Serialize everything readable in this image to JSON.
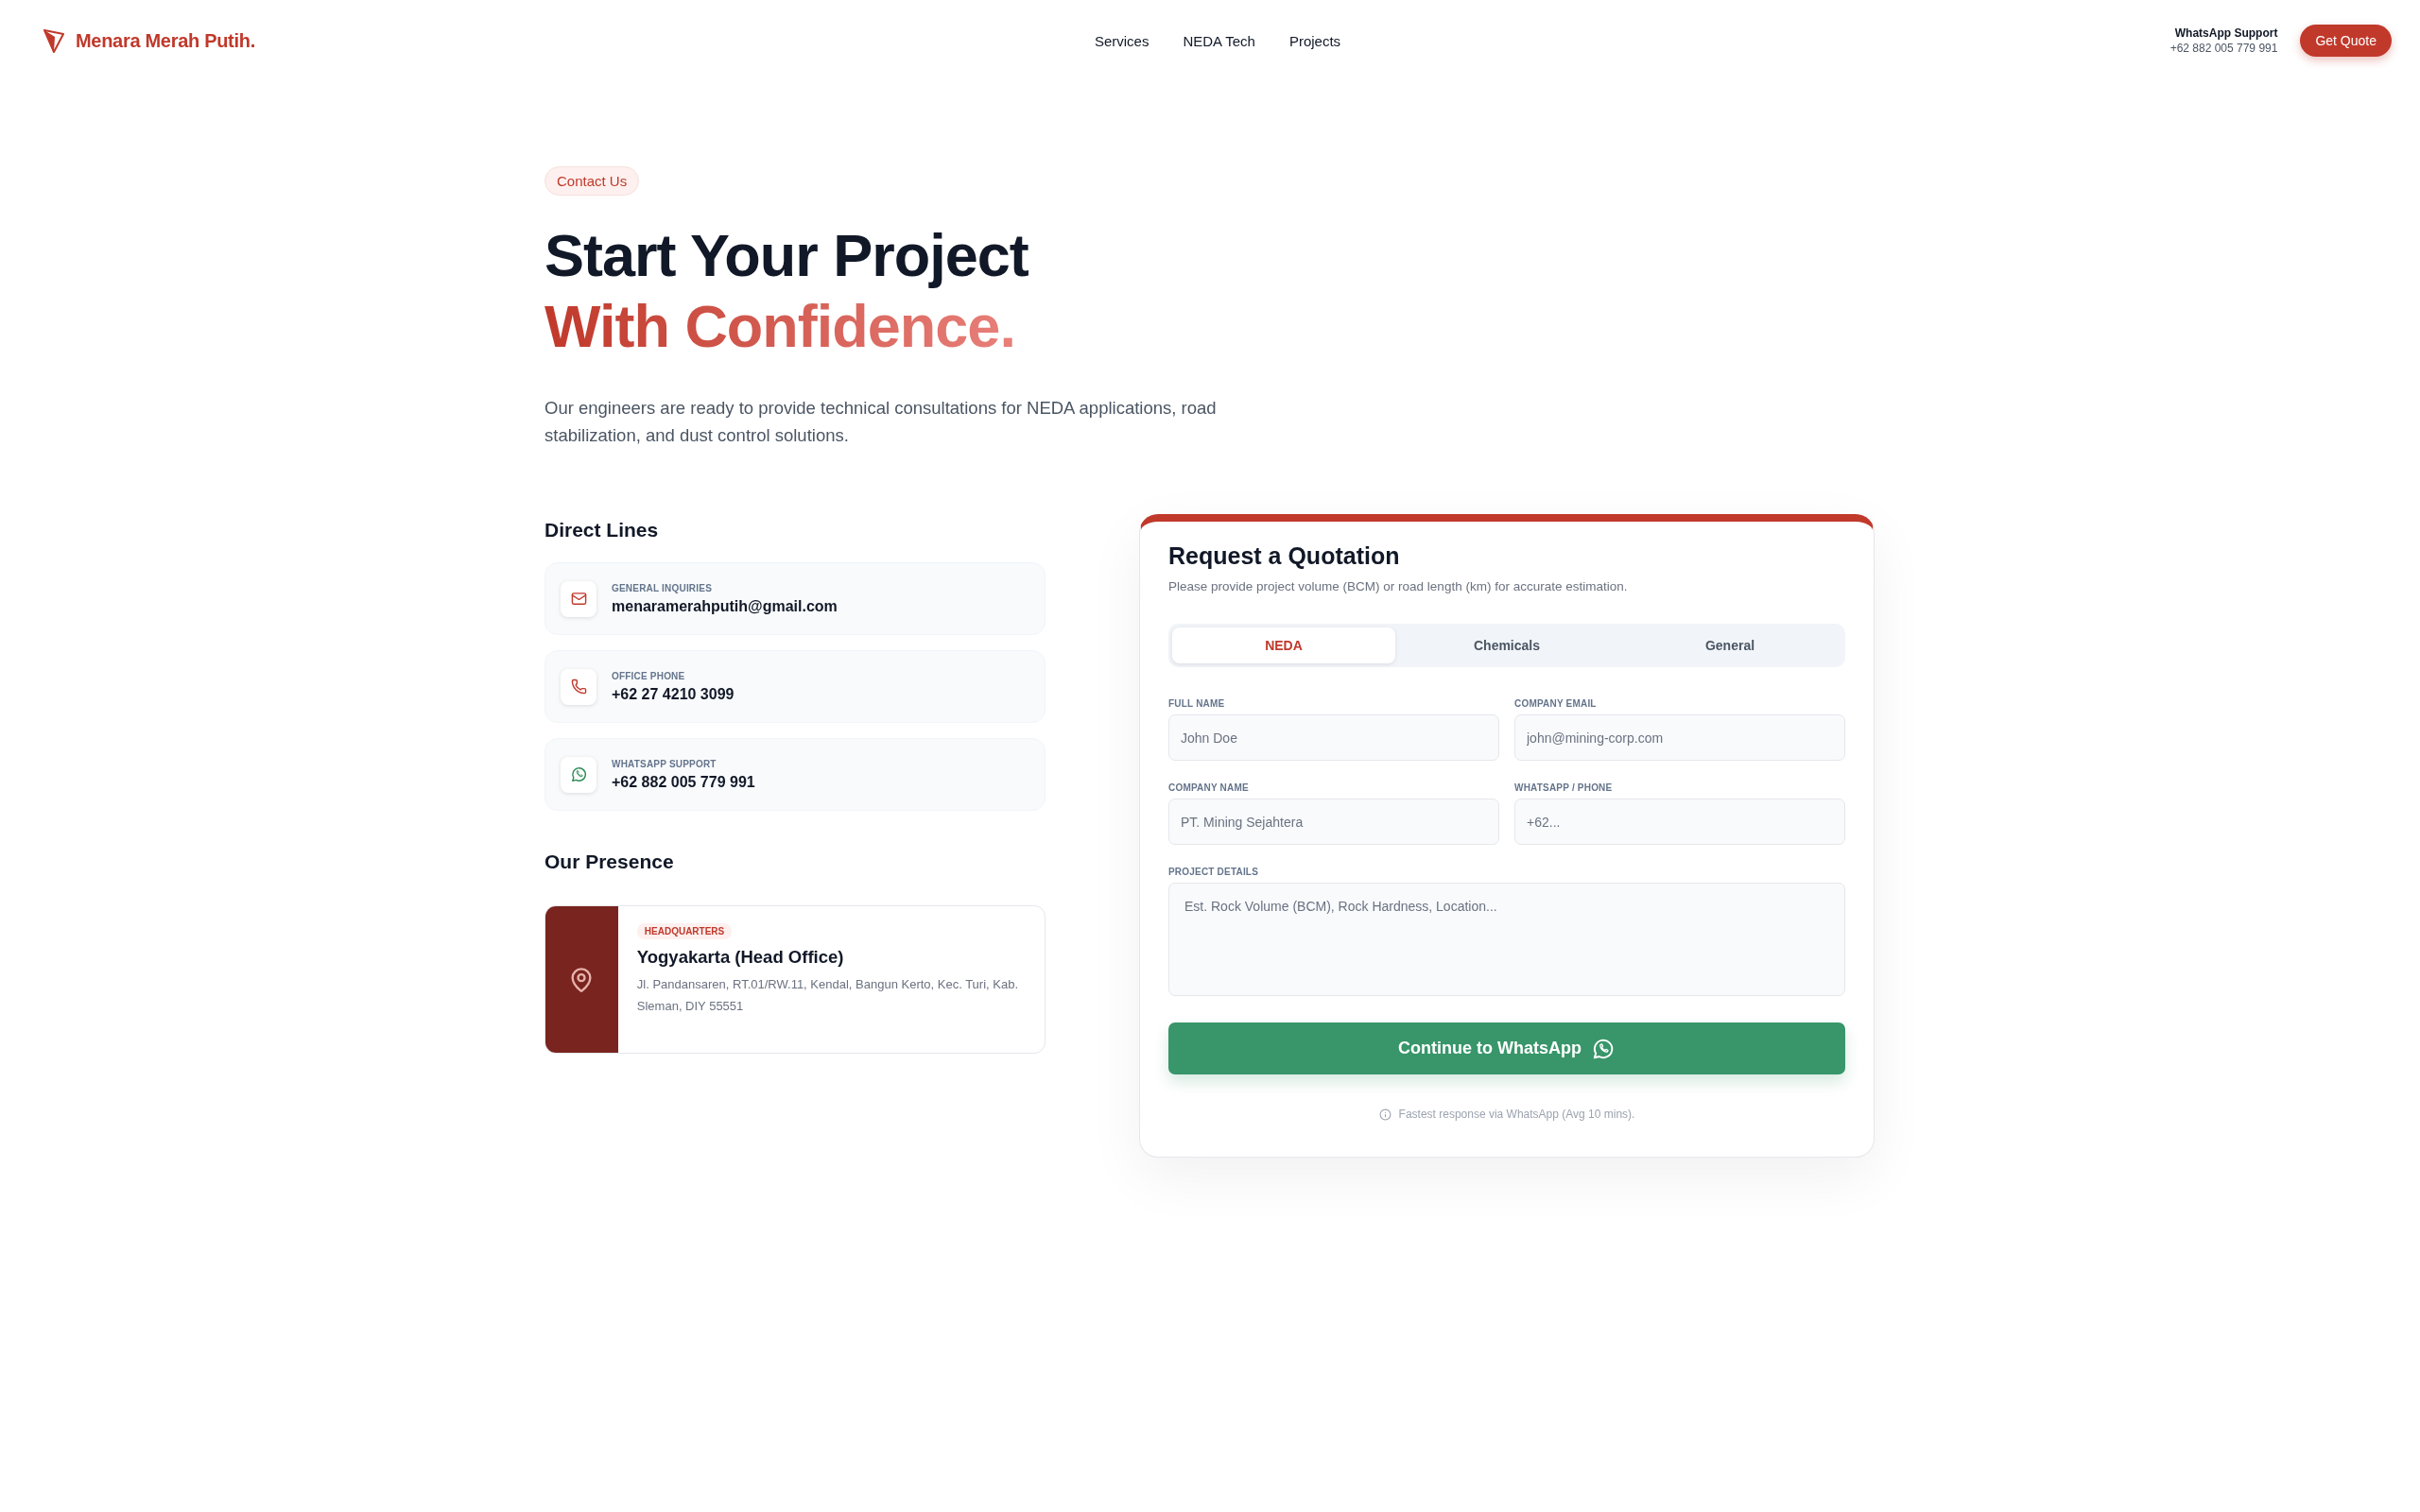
{
  "header": {
    "brand": "Menara Merah Putih.",
    "nav": [
      {
        "label": "Services"
      },
      {
        "label": "NEDA Tech"
      },
      {
        "label": "Projects"
      }
    ],
    "support_label": "WhatsApp Support",
    "support_phone": "+62 882 005 779 991",
    "cta": "Get Quote"
  },
  "hero": {
    "badge": "Contact Us",
    "title_line1": "Start Your Project",
    "title_line2": "With Confidence.",
    "description": "Our engineers are ready to provide technical consultations for NEDA applications, road stabilization, and dust control solutions."
  },
  "direct_lines": {
    "title": "Direct Lines",
    "items": [
      {
        "kind": "email",
        "label": "GENERAL INQUIRIES",
        "value": "menaramerahputih@gmail.com"
      },
      {
        "kind": "phone",
        "label": "OFFICE PHONE",
        "value": "+62 27 4210 3099"
      },
      {
        "kind": "whatsapp",
        "label": "WHATSAPP SUPPORT",
        "value": "+62 882 005 779 991"
      }
    ]
  },
  "presence": {
    "title": "Our Presence",
    "office": {
      "tag": "HEADQUARTERS",
      "name": "Yogyakarta (Head Office)",
      "address": "Jl. Pandansaren, RT.01/RW.11, Kendal, Bangun Kerto, Kec. Turi, Kab. Sleman, DIY 55551"
    }
  },
  "quote_form": {
    "title": "Request a Quotation",
    "subtitle": "Please provide project volume (BCM) or road length (km) for accurate estimation.",
    "tabs": [
      {
        "label": "NEDA",
        "selected": true
      },
      {
        "label": "Chemicals",
        "selected": false
      },
      {
        "label": "General",
        "selected": false
      }
    ],
    "fields": [
      {
        "kind": "input",
        "label": "FULL NAME",
        "placeholder": "John Doe"
      },
      {
        "kind": "input",
        "label": "COMPANY EMAIL",
        "placeholder": "john@mining-corp.com"
      },
      {
        "kind": "input",
        "label": "COMPANY NAME",
        "placeholder": "PT. Mining Sejahtera"
      },
      {
        "kind": "input",
        "label": "WHATSAPP / PHONE",
        "placeholder": "+62..."
      },
      {
        "kind": "textarea",
        "label": "PROJECT DETAILS",
        "placeholder": "Est. Rock Volume (BCM), Rock Hardness, Location..."
      }
    ],
    "submit": "Continue to WhatsApp",
    "note": "Fastest response via WhatsApp (Avg 10 mins)."
  }
}
